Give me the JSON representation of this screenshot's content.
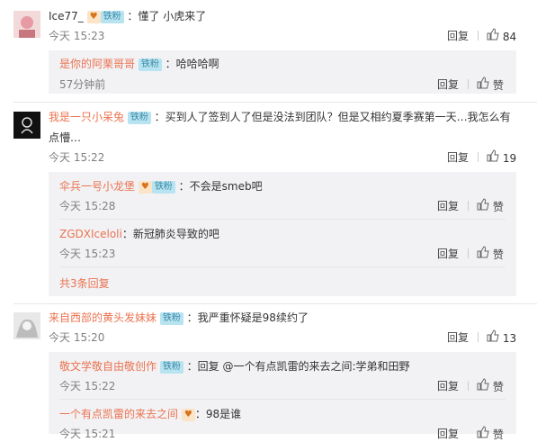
{
  "comments": [
    {
      "user": "Ice77_",
      "badge": "铁粉",
      "text": "：懂了 小虎来了",
      "time": "今天 15:23",
      "reply": "回复",
      "likes": "84"
    },
    {
      "user": "我是一只小呆兔",
      "badge": "铁粉",
      "text_line1": "：买到人了签到人了但是没法到团队？但是又相约夏季赛第一天…我怎么有",
      "text_line2": "点懵…",
      "time": "今天 15:22",
      "reply": "回复",
      "likes": "19"
    },
    {
      "user": "来自西部的黄头发妹妹",
      "badge": "铁粉",
      "text": "：我严重怀疑是98续约了",
      "time": "今天 15:20",
      "reply": "回复",
      "likes": "13"
    }
  ],
  "replies": [
    {
      "user": "是你的阿栗哥哥",
      "badge": "铁粉",
      "text": "：哈哈哈啊",
      "time": "57分钟前",
      "reply": "回复",
      "like": "赞"
    },
    {
      "user": "伞兵一号小龙堡",
      "badge": "铁粉",
      "text": "：不会是smeb吧",
      "time": "今天 15:28",
      "reply": "回复",
      "like": "赞"
    },
    {
      "user": "ZGDXIceloli",
      "text": "：新冠肺炎导致的吧",
      "time": "今天 15:23",
      "reply": "回复",
      "like": "赞"
    },
    {
      "user": "敬文学敬自由敬创作",
      "badge": "铁粉",
      "text": "：回复 @一个有点凯雷的来去之间:学弟和田野",
      "time": "今天 15:22",
      "reply": "回复",
      "like": "赞"
    },
    {
      "user": "一个有点凯雷的来去之间",
      "text": "：98是谁",
      "time": "今天 15:21",
      "reply": "回复",
      "like": "赞"
    }
  ],
  "more_replies": "共3条回复",
  "colors": {
    "link": "#eb7350",
    "reply_bg": "#f2f2f5",
    "badge_fan": "#b8e3f0"
  }
}
